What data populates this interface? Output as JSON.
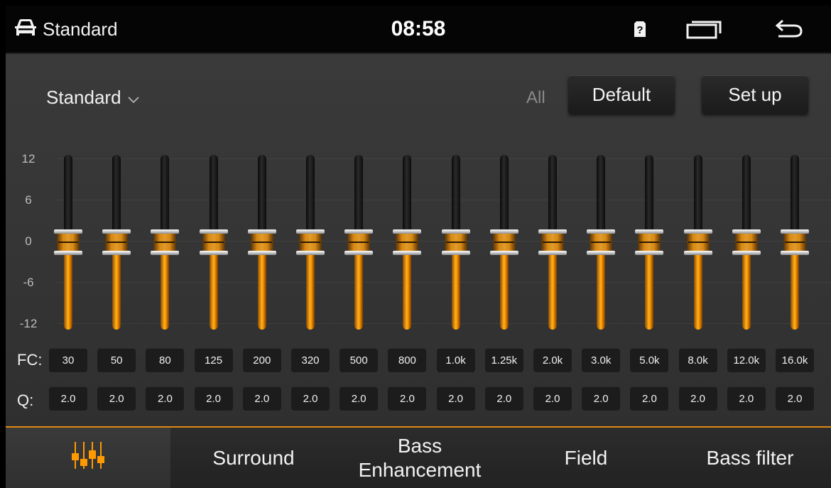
{
  "status_bar": {
    "title": "Standard",
    "time": "08:58",
    "icons": [
      "car-icon",
      "sim-unknown-icon",
      "recent-apps-icon",
      "back-icon"
    ]
  },
  "toolbar": {
    "preset": "Standard",
    "all_label": "All",
    "default_label": "Default",
    "setup_label": "Set up"
  },
  "scale": [
    "12",
    "6",
    "0",
    "-6",
    "-12"
  ],
  "eq": {
    "fc_label": "FC:",
    "q_label": "Q:",
    "bands": [
      {
        "fc": "30",
        "q": "2.0",
        "gain": 0
      },
      {
        "fc": "50",
        "q": "2.0",
        "gain": 0
      },
      {
        "fc": "80",
        "q": "2.0",
        "gain": 0
      },
      {
        "fc": "125",
        "q": "2.0",
        "gain": 0
      },
      {
        "fc": "200",
        "q": "2.0",
        "gain": 0
      },
      {
        "fc": "320",
        "q": "2.0",
        "gain": 0
      },
      {
        "fc": "500",
        "q": "2.0",
        "gain": 0
      },
      {
        "fc": "800",
        "q": "2.0",
        "gain": 0
      },
      {
        "fc": "1.0k",
        "q": "2.0",
        "gain": 0
      },
      {
        "fc": "1.25k",
        "q": "2.0",
        "gain": 0
      },
      {
        "fc": "2.0k",
        "q": "2.0",
        "gain": 0
      },
      {
        "fc": "3.0k",
        "q": "2.0",
        "gain": 0
      },
      {
        "fc": "5.0k",
        "q": "2.0",
        "gain": 0
      },
      {
        "fc": "8.0k",
        "q": "2.0",
        "gain": 0
      },
      {
        "fc": "12.0k",
        "q": "2.0",
        "gain": 0
      },
      {
        "fc": "16.0k",
        "q": "2.0",
        "gain": 0
      }
    ]
  },
  "tabs": [
    {
      "label": "",
      "icon": "equalizer-icon",
      "active": true
    },
    {
      "label": "Surround",
      "active": false
    },
    {
      "label": "Bass\nEnhancement",
      "active": false
    },
    {
      "label": "Field",
      "active": false
    },
    {
      "label": "Bass filter",
      "active": false
    }
  ],
  "colors": {
    "accent": "#ff9a00",
    "background": "#353535",
    "cell": "#1c1c1c"
  }
}
